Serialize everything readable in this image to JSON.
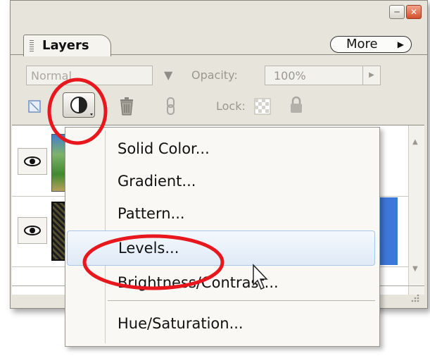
{
  "panel": {
    "tab_label": "Layers",
    "more_label": "More",
    "blend_mode": "Normal",
    "opacity_label": "Opacity:",
    "opacity_value": "100%",
    "lock_label": "Lock:"
  },
  "menu": {
    "items": [
      {
        "label": "Solid Color..."
      },
      {
        "label": "Gradient..."
      },
      {
        "label": "Pattern..."
      },
      {
        "label": "Levels..."
      },
      {
        "label": "Brightness/Contrast..."
      },
      {
        "label": "Hue/Saturation..."
      }
    ],
    "hovered_item": "Levels..."
  },
  "icons": {
    "visibility": "eye-icon",
    "adjustment_layer": "half-circle-adjustment-icon",
    "delete": "trash-icon",
    "link": "chain-link-icon",
    "lock_transparency": "checkerboard-icon",
    "lock_all": "padlock-icon",
    "cursor": "mouse-pointer-icon"
  },
  "colors": {
    "annotation_red": "#e8161d",
    "selection_blue": "#3d78d8",
    "menu_hover": "#dfeaf7"
  }
}
